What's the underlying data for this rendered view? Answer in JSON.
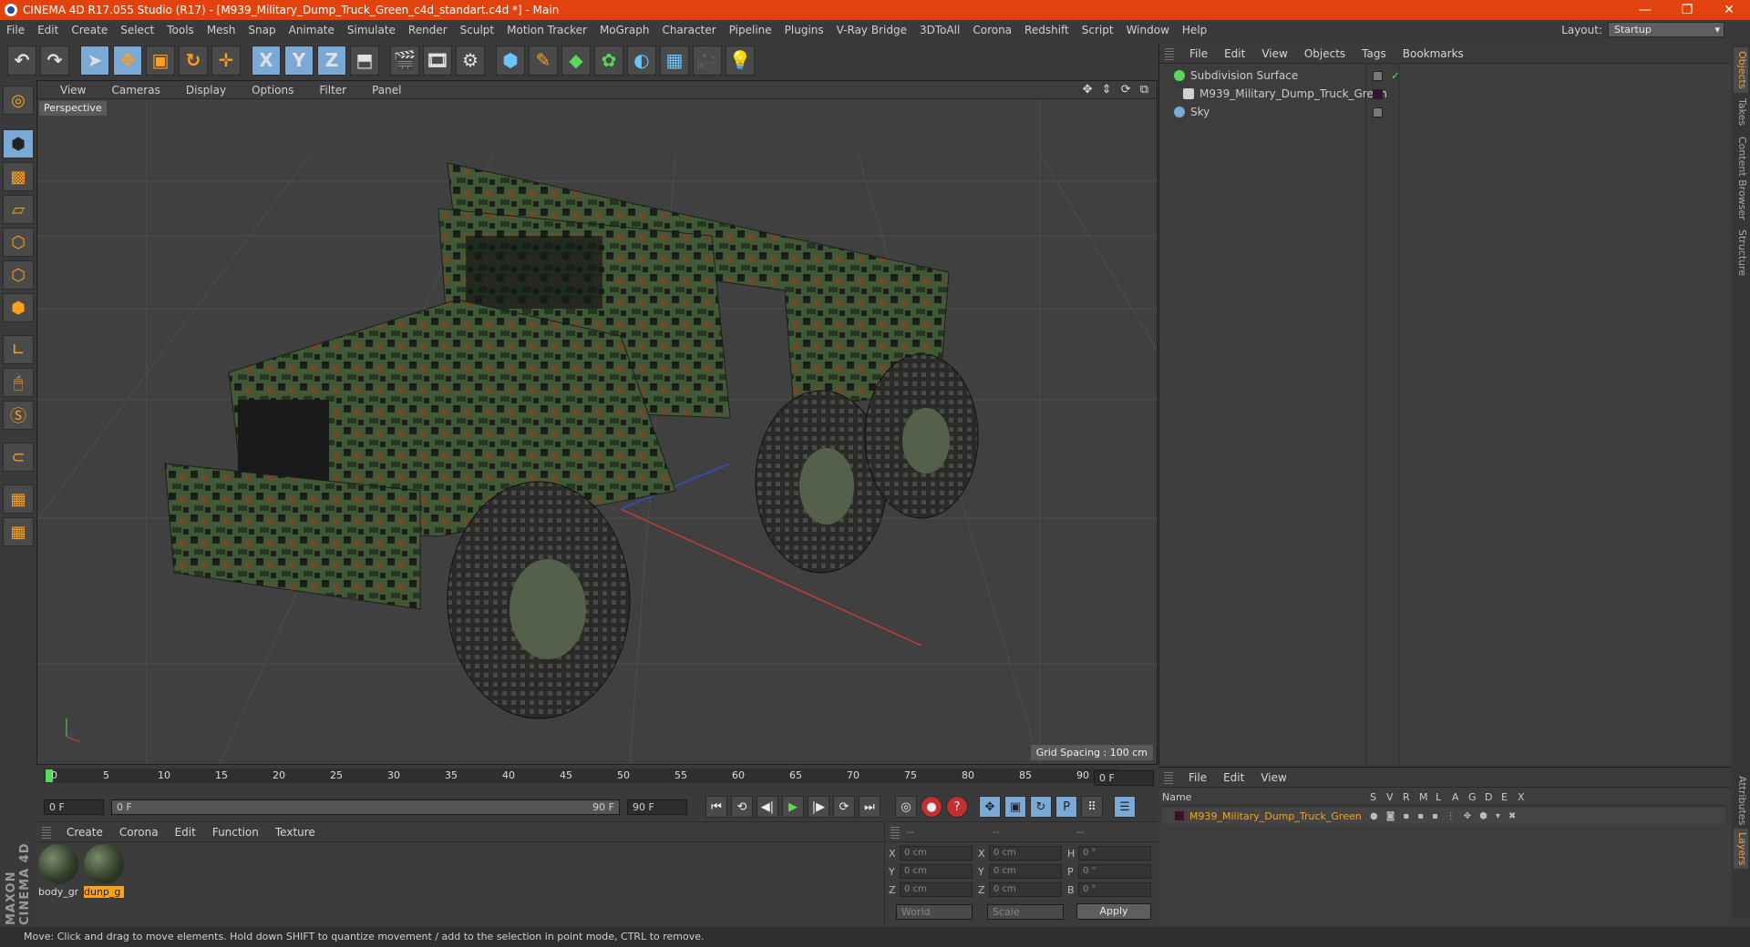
{
  "window": {
    "title": "CINEMA 4D R17.055 Studio (R17) - [M939_Military_Dump_Truck_Green_c4d_standart.c4d *] - Main",
    "controls": [
      "—",
      "❐",
      "✕"
    ]
  },
  "menubar": [
    "File",
    "Edit",
    "Create",
    "Select",
    "Tools",
    "Mesh",
    "Snap",
    "Animate",
    "Simulate",
    "Render",
    "Sculpt",
    "Motion Tracker",
    "MoGraph",
    "Character",
    "Pipeline",
    "Plugins",
    "V-Ray Bridge",
    "3DToAll",
    "Corona",
    "Redshift",
    "Script",
    "Window",
    "Help"
  ],
  "layout": {
    "label": "Layout:",
    "value": "Startup"
  },
  "toolbar": {
    "undo": "↶",
    "redo": "↷",
    "select": "➤",
    "move": "✥",
    "scale": "▣",
    "rotate": "↻",
    "transform": "✛",
    "x": "X",
    "y": "Y",
    "z": "Z",
    "coord": "⬒",
    "render_view": "🎬",
    "render_picture": "🎞",
    "render_settings": "⚙",
    "cube": "⬢",
    "pen": "✎",
    "subdiv": "◆",
    "cloner": "✿",
    "deformer": "◐",
    "floor": "▦",
    "camera": "🎥",
    "light": "💡"
  },
  "viewport": {
    "menu": [
      "View",
      "Cameras",
      "Display",
      "Options",
      "Filter",
      "Panel"
    ],
    "label": "Perspective",
    "grid_spacing": "Grid Spacing : 100 cm",
    "nav_icons": "✥ ⇕ ⟳ ⧉"
  },
  "objects_panel": {
    "menu": [
      "File",
      "Edit",
      "View",
      "Objects",
      "Tags",
      "Bookmarks"
    ],
    "rows": [
      {
        "name": "Subdivision Surface",
        "color": "#5ad85a"
      },
      {
        "name": "M939_Military_Dump_Truck_Green",
        "color": "#d0d0d0"
      },
      {
        "name": "Sky",
        "color": "#7aa9d6"
      }
    ]
  },
  "side_tabs": [
    "Objects",
    "Takes",
    "Content Browser",
    "Structure"
  ],
  "side_tabs_bottom": [
    "Attributes",
    "Layers"
  ],
  "timeline": {
    "ticks": [
      "0",
      "5",
      "10",
      "15",
      "20",
      "25",
      "30",
      "35",
      "40",
      "45",
      "50",
      "55",
      "60",
      "65",
      "70",
      "75",
      "80",
      "85",
      "90"
    ],
    "current_frame": "0 F",
    "start": "0 F",
    "slider_start": "0 F",
    "slider_end": "90 F",
    "end": "90 F"
  },
  "playback": [
    "⏮",
    "⟲",
    "◀|",
    "▶",
    "|▶",
    "⟳",
    "⏭"
  ],
  "materials": {
    "menu": [
      "Create",
      "Corona",
      "Edit",
      "Function",
      "Texture"
    ],
    "items": [
      {
        "label": "body_gr",
        "selected": false
      },
      {
        "label": "dunp_g",
        "selected": true
      }
    ]
  },
  "coordinates": {
    "headers": [
      "--",
      "--",
      "--"
    ],
    "rows": [
      {
        "a": "X",
        "av": "0 cm",
        "b": "X",
        "bv": "0 cm",
        "c": "H",
        "cv": "0 °"
      },
      {
        "a": "Y",
        "av": "0 cm",
        "b": "Y",
        "bv": "0 cm",
        "c": "P",
        "cv": "0 °"
      },
      {
        "a": "Z",
        "av": "0 cm",
        "b": "Z",
        "bv": "0 cm",
        "c": "B",
        "cv": "0 °"
      }
    ],
    "world": "World",
    "scale": "Scale",
    "apply": "Apply"
  },
  "layers_panel": {
    "menu": [
      "File",
      "Edit",
      "View"
    ],
    "name_header": "Name",
    "cols": [
      "S",
      "V",
      "R",
      "M",
      "L",
      "A",
      "G",
      "D",
      "E",
      "X"
    ],
    "row": "M939_Military_Dump_Truck_Green"
  },
  "status": "Move: Click and drag to move elements. Hold down SHIFT to quantize movement / add to the selection in point mode, CTRL to remove.",
  "maxon": "MAXON CINEMA 4D",
  "colors": {
    "accent": "#e2430e",
    "selection": "#f7a21b",
    "active_tool": "#7aa9d6"
  }
}
